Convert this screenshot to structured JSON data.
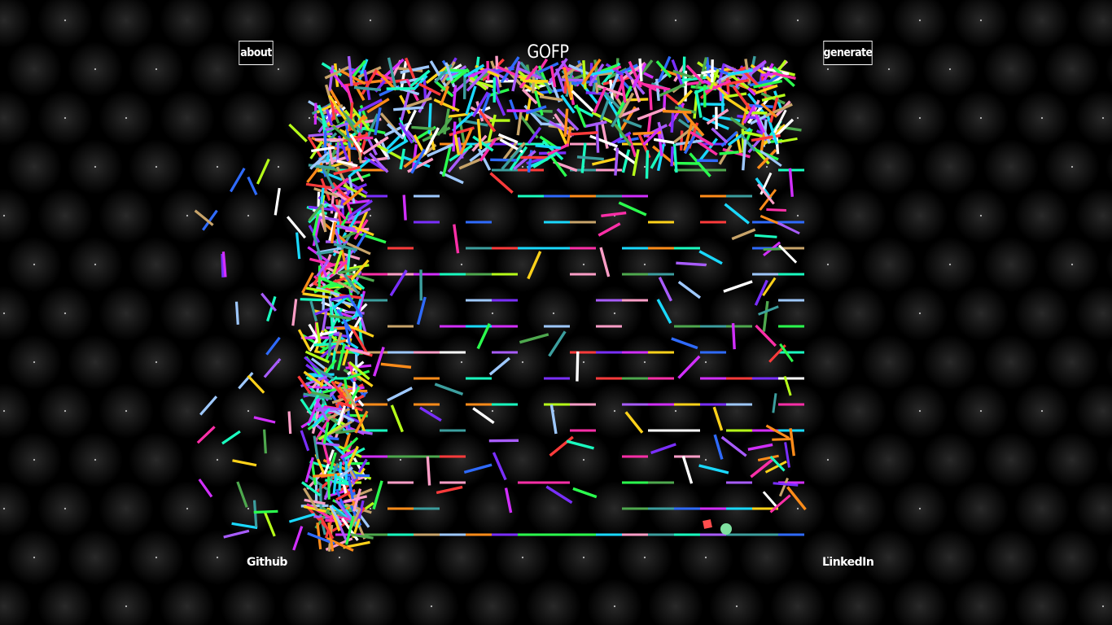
{
  "header": {
    "title": "GOFP",
    "about_label": "about",
    "generate_label": "generate"
  },
  "footer": {
    "github_label": "Github",
    "linkedin_label": "LinkedIn"
  },
  "colors": {
    "background": "#000000",
    "glow": "#ffffff",
    "player": "#ff4d4d",
    "goal": "#7fe0a0",
    "wall_palette": [
      "#ff3b3b",
      "#ff8c1a",
      "#ffd21a",
      "#b6ff1a",
      "#2bff4e",
      "#1affc0",
      "#1ad9ff",
      "#2f6bff",
      "#7a2fff",
      "#d22fff",
      "#ff2fa8",
      "#ff9ec7",
      "#9ec8ff",
      "#ffffff",
      "#c8a46a",
      "#4ea84e",
      "#3c9e9e",
      "#a85cff"
    ]
  },
  "icons": {
    "player": "red-square-icon",
    "goal": "green-circle-icon"
  }
}
